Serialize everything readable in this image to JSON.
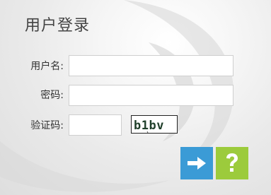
{
  "login": {
    "title": "用户登录",
    "username_label": "用户名:",
    "username_value": "",
    "password_label": "密码:",
    "password_value": "",
    "captcha_label": "验证码:",
    "captcha_value": "",
    "captcha_image_text": "b1bv"
  },
  "buttons": {
    "login_icon": "arrow-right-icon",
    "help_icon": "question-mark-icon",
    "login_color": "#3b9bd6",
    "help_color": "#9ccb3c"
  }
}
